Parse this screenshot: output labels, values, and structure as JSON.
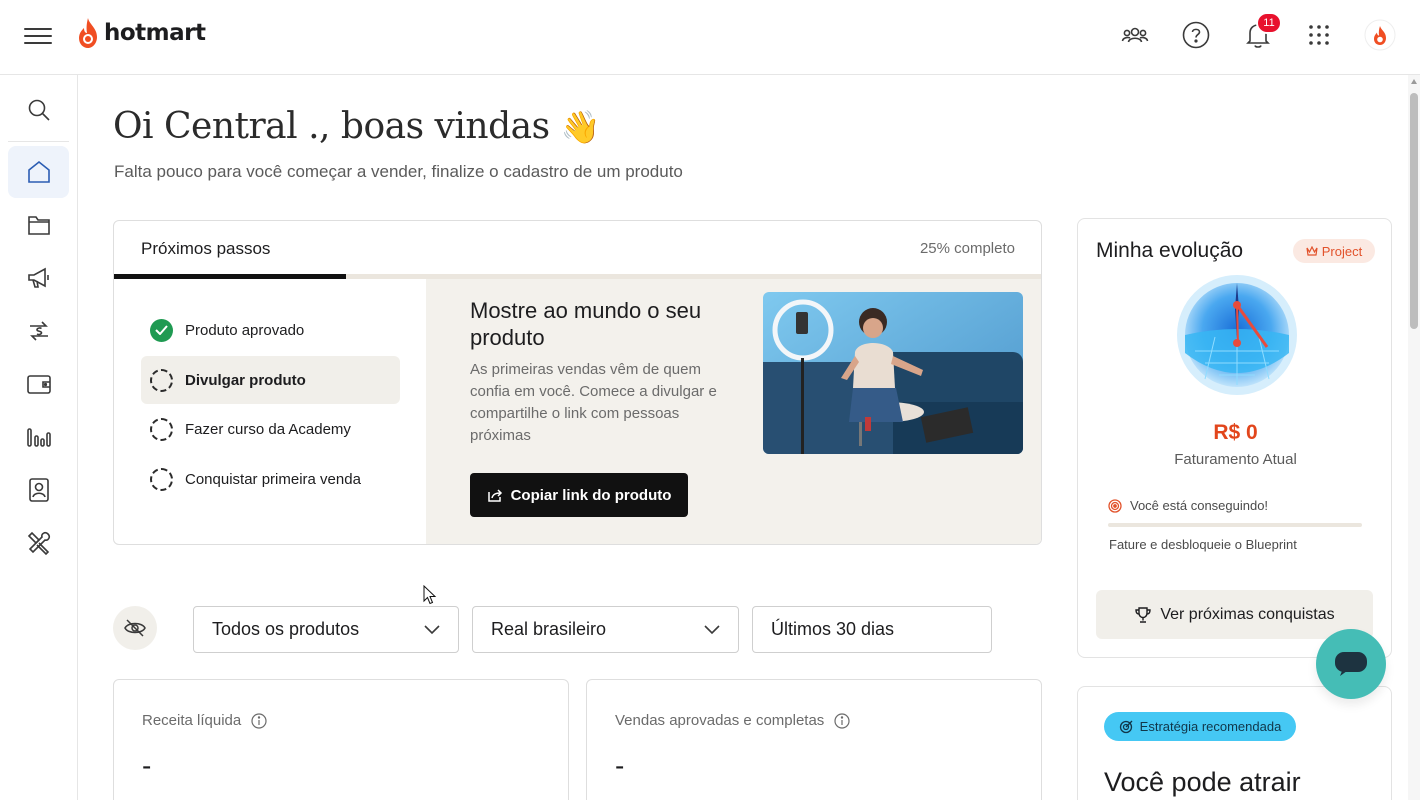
{
  "header": {
    "logo_text": "hotmart",
    "notification_count": "11",
    "icons": [
      "menu-icon",
      "community-icon",
      "help-icon",
      "bell-icon",
      "apps-grid-icon",
      "profile-icon"
    ]
  },
  "sidebar": {
    "items": [
      {
        "name": "search-icon",
        "active": false
      },
      {
        "name": "home-icon",
        "active": true
      },
      {
        "name": "folder-icon",
        "active": false
      },
      {
        "name": "megaphone-icon",
        "active": false
      },
      {
        "name": "money-transfer-icon",
        "active": false
      },
      {
        "name": "wallet-icon",
        "active": false
      },
      {
        "name": "bar-chart-icon",
        "active": false
      },
      {
        "name": "contact-card-icon",
        "active": false
      },
      {
        "name": "tools-icon",
        "active": false
      }
    ]
  },
  "page": {
    "greeting": "Oi Central ., boas vindas",
    "greeting_emoji": "👋",
    "subtitle": "Falta pouco para você começar a vender, finalize o cadastro de um produto"
  },
  "steps": {
    "title": "Próximos passos",
    "progress_label": "25% completo",
    "progress": 0.25,
    "items": [
      {
        "label": "Produto aprovado",
        "status": "done"
      },
      {
        "label": "Divulgar produto",
        "status": "active"
      },
      {
        "label": "Fazer curso da Academy",
        "status": "pending"
      },
      {
        "label": "Conquistar primeira venda",
        "status": "pending"
      }
    ],
    "detail": {
      "title": "Mostre ao mundo o seu produto",
      "text": "As primeiras vendas vêm de quem confia em você. Comece a divulgar e compartilhe o link com pessoas próximas",
      "button": "Copiar link do produto"
    }
  },
  "filters": {
    "product": "Todos os produtos",
    "currency": "Real brasileiro",
    "period": "Últimos 30 dias"
  },
  "metrics": [
    {
      "label": "Receita líquida",
      "value": "-"
    },
    {
      "label": "Vendas aprovadas e completas",
      "value": "-"
    }
  ],
  "evolution": {
    "title": "Minha evolução",
    "badge": "Project",
    "revenue": "R$ 0",
    "revenue_label": "Faturamento Atual",
    "achievement": "Você está conseguindo!",
    "unlock_text": "Fature e desbloqueie o Blueprint",
    "button": "Ver próximas conquistas"
  },
  "strategy": {
    "badge": "Estratégia recomendada",
    "title": "Você pode atrair"
  },
  "colors": {
    "brand": "#f04e23",
    "success": "#1f9a52",
    "chat": "#45bdb6",
    "strategy": "#45c8f4"
  }
}
